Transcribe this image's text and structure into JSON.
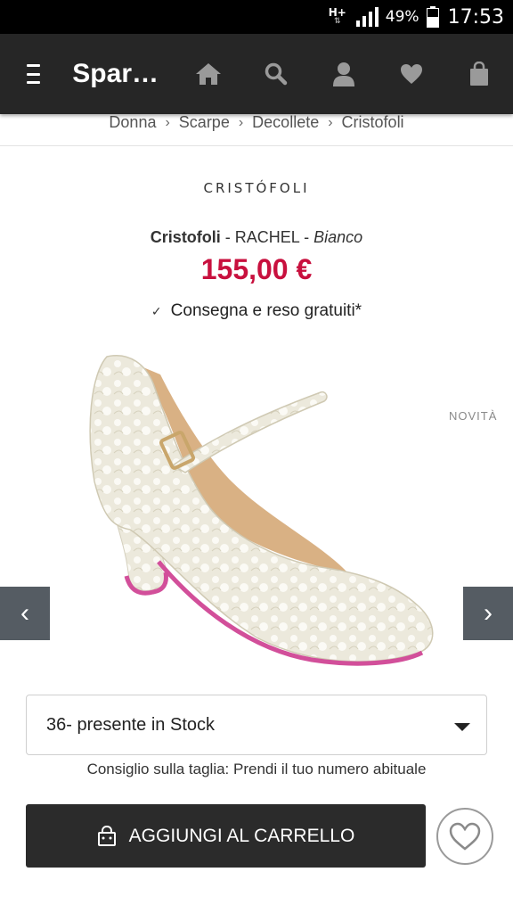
{
  "status_bar": {
    "network": "H+",
    "battery_percent": "49%",
    "time": "17:53"
  },
  "header": {
    "brand": "Spar…",
    "icons": [
      "home-icon",
      "search-icon",
      "user-icon",
      "heart-icon",
      "bag-icon"
    ]
  },
  "breadcrumb": {
    "items": [
      "Donna",
      "Scarpe",
      "Decollete",
      "Cristofoli"
    ],
    "separator": "›"
  },
  "product": {
    "brand_logo": "CRISTÓFOLI",
    "brand": "Cristofoli",
    "dash1": " - ",
    "model": "RACHEL",
    "dash2": " - ",
    "color": "Bianco",
    "price": "155,00 €",
    "shipping": "Consegna e reso gratuiti*",
    "check_mark": "✓",
    "badge": "NOVITÀ"
  },
  "gallery": {
    "prev": "‹",
    "next": "›"
  },
  "size_select": {
    "value": "36- presente in Stock",
    "hint": "Consiglio sulla taglia: Prendi il tuo numero abituale"
  },
  "cart": {
    "add_label": "AGGIUNGI AL CARRELLO"
  },
  "colors": {
    "header_bg": "#262626",
    "price": "#c8103e",
    "button_bg": "#2b2b2b",
    "arrow_bg": "#555c63"
  }
}
